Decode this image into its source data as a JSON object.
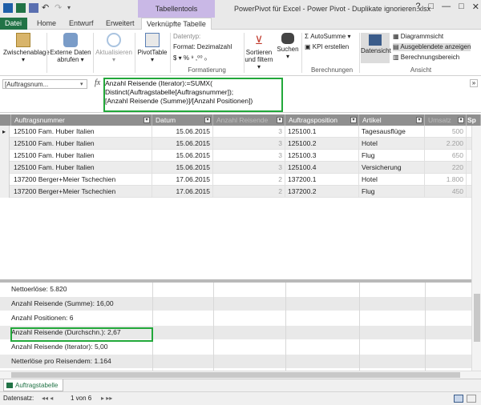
{
  "window": {
    "title": "PowerPivot für Excel - Power Pivot - Duplikate ignorieren.xlsx",
    "context_tab": "Tabellentools",
    "controls": [
      "?",
      "□",
      "—",
      "□",
      "✕"
    ]
  },
  "ribbon_tabs": [
    "Datei",
    "Home",
    "Entwurf",
    "Erweitert",
    "Verknüpfte Tabelle"
  ],
  "ribbon": {
    "paste_label": "Zwischenablage",
    "external_label": "Externe Daten abrufen",
    "refresh_label": "Aktualisieren",
    "pivot_label": "PivotTable",
    "datatype_label": "Datentyp:",
    "format_label": "Format: Dezimalzahl",
    "format_symbols": "$ ▾ % ⁹ ,⁰⁰ ₀",
    "group_formatierung": "Formatierung",
    "sort_label": "Sortieren und filtern",
    "search_label": "Suchen",
    "autosum_label": "AutoSumme",
    "kpi_label": "KPI erstellen",
    "group_berechnungen": "Berechnungen",
    "dataview_label": "Datensicht",
    "diagram_label": "Diagrammsicht",
    "hidden_label": "Ausgeblendete anzeigen",
    "calcarea_label": "Berechnungsbereich",
    "group_ansicht": "Ansicht"
  },
  "formula_bar": {
    "namebox": "[Auftragsnum...",
    "line1": "Anzahl Reisende (Iterator):=SUMX(",
    "line2": "Distinct(Auftragstabelle[Auftragsnummer]);",
    "line3": "[Anzahl Reisende (Summe)]/[Anzahl Positionen])"
  },
  "columns": [
    "Auftragsnummer",
    "Datum",
    "Anzahl Reisende",
    "Auftragsposition",
    "Artikel",
    "Umsatz",
    "Sp"
  ],
  "rows": [
    [
      "125100 Fam. Huber Italien",
      "15.06.2015",
      "3",
      "125100.1",
      "Tagesausflüge",
      "500"
    ],
    [
      "125100 Fam. Huber Italien",
      "15.06.2015",
      "3",
      "125100.2",
      "Hotel",
      "2.200"
    ],
    [
      "125100 Fam. Huber Italien",
      "15.06.2015",
      "3",
      "125100.3",
      "Flug",
      "650"
    ],
    [
      "125100 Fam. Huber Italien",
      "15.06.2015",
      "3",
      "125100.4",
      "Versicherung",
      "220"
    ],
    [
      "137200 Berger+Meier Tschechien",
      "17.06.2015",
      "2",
      "137200.1",
      "Hotel",
      "1.800"
    ],
    [
      "137200 Berger+Meier Tschechien",
      "17.06.2015",
      "2",
      "137200.2",
      "Flug",
      "450"
    ]
  ],
  "measures": [
    "Nettoerlöse: 5.820",
    "Anzahl Reisende (Summe): 16,00",
    "Anzahl Positionen: 6",
    "Anzahl Reisende (Durchschn.): 2,67",
    "Anzahl Reisende (Iterator): 5,00",
    "Netterlöse pro Reisendem: 1.164"
  ],
  "sheet_tab": "Auftragstabelle",
  "status": {
    "label": "Datensatz:",
    "nav_left": "◂◂ ◂",
    "record": "1 von 6",
    "nav_right": "▸ ▸▸"
  },
  "colors": {
    "excel_green": "#217346",
    "context_purple": "#c9b8e6",
    "header_gray": "#8f8f8f",
    "highlight_green": "#22a83a"
  }
}
